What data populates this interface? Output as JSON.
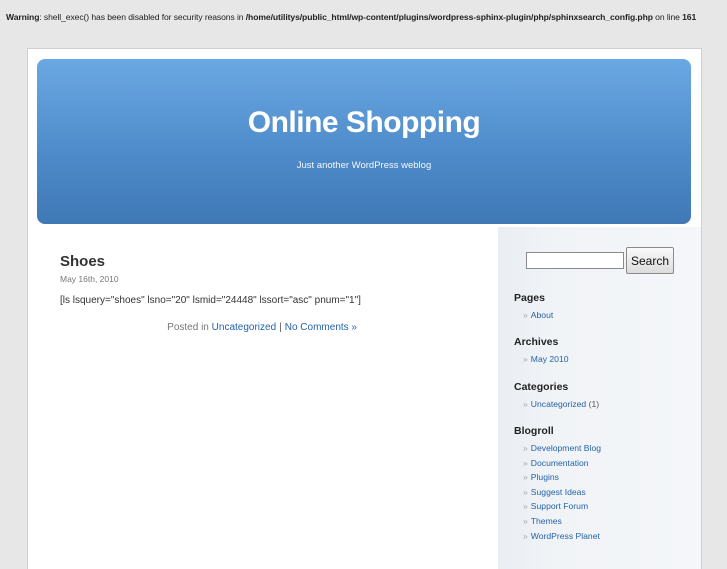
{
  "warning": {
    "label": "Warning",
    "message": ": shell_exec() has been disabled for security reasons in ",
    "path": "/home/utilitys/public_html/wp-content/plugins/wordpress-sphinx-plugin/php/sphinxsearch_config.php",
    "line_text": " on line ",
    "line_number": "161"
  },
  "header": {
    "title": "Online Shopping",
    "description": "Just another WordPress weblog"
  },
  "post": {
    "title": "Shoes",
    "date": "May 16th, 2010",
    "content": "[ls lsquery=\"shoes\" lsno=\"20\" lsmid=\"24448\" lssort=\"asc\" pnum=\"1\"]",
    "meta": {
      "posted_in": "Posted in ",
      "category": "Uncategorized",
      "separator": "|",
      "comments": "No Comments »"
    }
  },
  "sidebar": {
    "search": {
      "button_label": "Search",
      "value": ""
    },
    "raquo": "»",
    "pages": {
      "title": "Pages",
      "items": [
        "About"
      ]
    },
    "archives": {
      "title": "Archives",
      "items": [
        "May 2010"
      ]
    },
    "categories": {
      "title": "Categories",
      "items": [
        {
          "label": "Uncategorized",
          "count": "(1)"
        }
      ]
    },
    "blogroll": {
      "title": "Blogroll",
      "items": [
        "Development Blog",
        "Documentation",
        "Plugins",
        "Suggest Ideas",
        "Support Forum",
        "Themes",
        "WordPress Planet"
      ]
    }
  },
  "colors": {
    "header_top": "#6aa8e3",
    "header_bottom": "#3f78b5",
    "link": "#2463a8",
    "page_bg": "#e7e7e7"
  }
}
